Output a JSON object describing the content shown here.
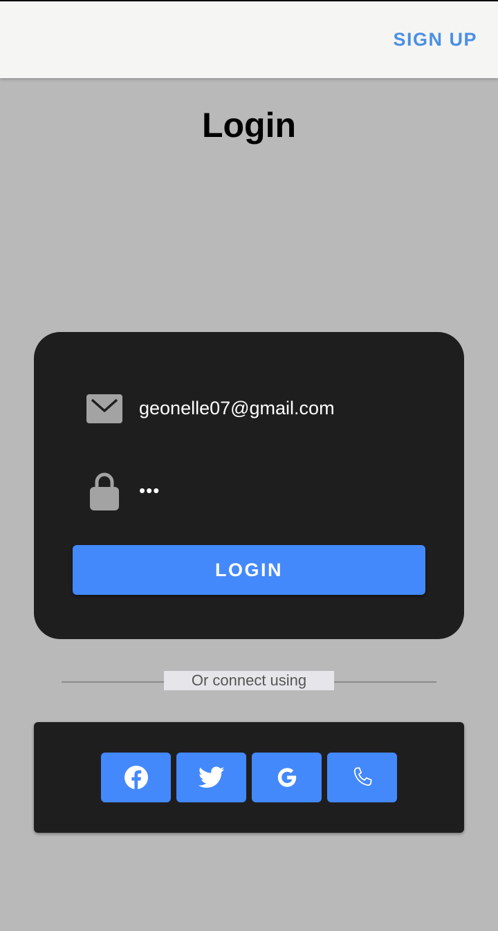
{
  "app_bar": {
    "signup_label": "SIGN UP"
  },
  "page": {
    "title": "Login"
  },
  "login_form": {
    "email_icon": "envelope-icon",
    "email_value": "geonelle07@gmail.com",
    "password_icon": "lock-icon",
    "password_value": "•••",
    "login_label": "LOGIN"
  },
  "divider": {
    "label": "Or connect using"
  },
  "social": {
    "buttons": [
      {
        "icon": "facebook-icon"
      },
      {
        "icon": "twitter-icon"
      },
      {
        "icon": "google-icon"
      },
      {
        "icon": "phone-icon"
      }
    ]
  },
  "colors": {
    "accent": "#4489fb",
    "signup_text": "#4a90e2",
    "card_background": "#1f1e1f",
    "page_background": "#b9b9b9",
    "app_bar_background": "#f5f5f4"
  }
}
